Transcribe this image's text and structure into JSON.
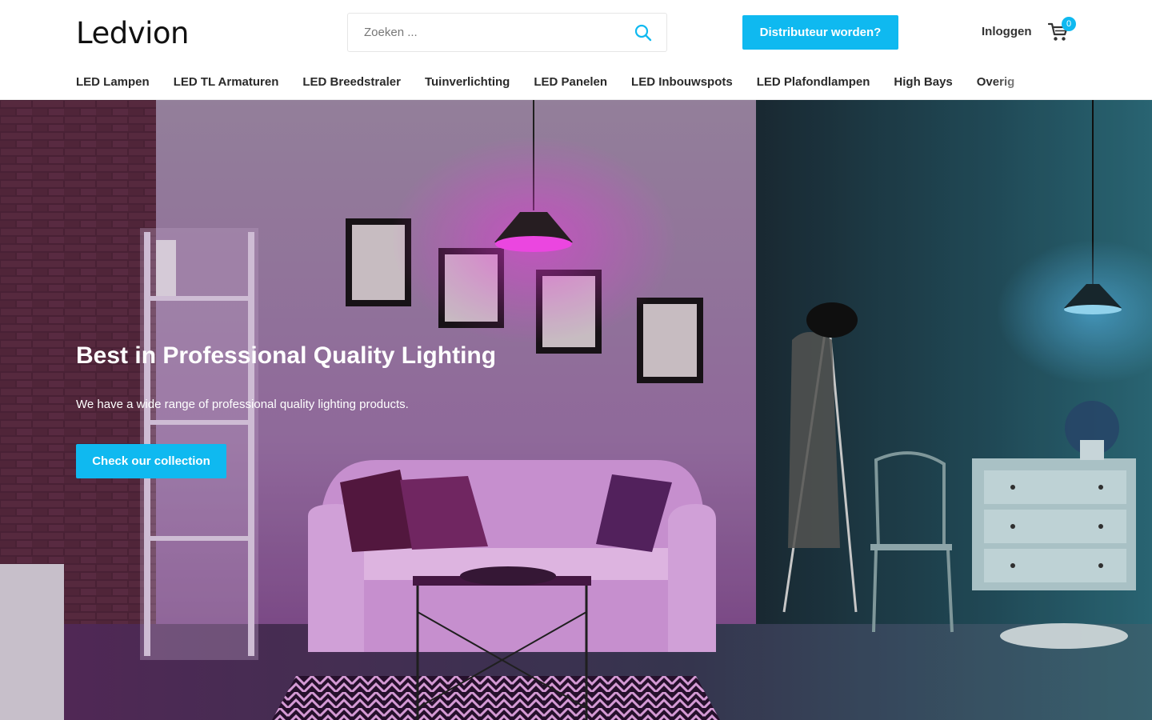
{
  "header": {
    "logo": "Ledvion",
    "search": {
      "placeholder": "Zoeken ..."
    },
    "distributor_button": "Distributeur worden?",
    "login": "Inloggen",
    "cart_count": "0"
  },
  "nav": {
    "items": [
      {
        "label": "LED Lampen"
      },
      {
        "label": "LED TL Armaturen"
      },
      {
        "label": "LED Breedstraler"
      },
      {
        "label": "Tuinverlichting"
      },
      {
        "label": "LED Panelen"
      },
      {
        "label": "LED Inbouwspots"
      },
      {
        "label": "LED Plafondlampen"
      },
      {
        "label": "High Bays"
      },
      {
        "label": "Overig"
      }
    ]
  },
  "hero": {
    "title": "Best in Professional Quality Lighting",
    "subtitle": "We have a wide range of professional quality lighting products.",
    "cta": "Check our collection"
  },
  "colors": {
    "accent": "#0fb9f0",
    "text_dark": "#222222"
  },
  "icons": {
    "search": "search-icon",
    "cart": "cart-icon"
  }
}
